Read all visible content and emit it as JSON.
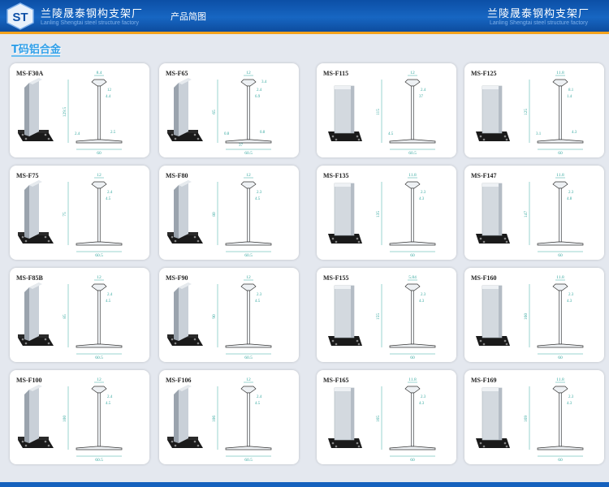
{
  "header": {
    "company_name": "兰陵晟泰钢构支架厂",
    "company_name_en": "Lanling Shengtai steel structure factory",
    "page_label": "产品简图",
    "company_name_right": "兰陵晟泰钢构支架厂",
    "company_name_right_en": "Lanling Shengtai steel structure factory",
    "logo_text": "ST"
  },
  "section": {
    "title": "T码铝合金"
  },
  "colors": {
    "header_blue": "#1766c2",
    "accent_orange": "#f4a21c",
    "dimension_teal": "#36a8a0",
    "title_blue": "#2e9ee8"
  },
  "cards": [
    {
      "id": "F30A",
      "label": "MS-F30A",
      "dims": [
        "8.4",
        "12",
        "4.4",
        "2.4",
        "129.5",
        "60",
        "2.5"
      ]
    },
    {
      "id": "F65",
      "label": "MS-F65",
      "dims": [
        "12",
        "2.4",
        "6.9",
        "65",
        "0.8",
        "0.8",
        "37",
        "3.4",
        "38",
        "60.5",
        "4.8"
      ]
    },
    {
      "id": "F115",
      "label": "MS-F115",
      "dims": [
        "12",
        "2.4",
        "115",
        "37",
        "60.5",
        "4.5"
      ]
    },
    {
      "id": "F125",
      "label": "MS-F125",
      "dims": [
        "11.8",
        "8.1",
        "1.4",
        "3.1",
        "125",
        "60",
        "4.3"
      ]
    },
    {
      "id": "F75",
      "label": "MS-F75",
      "dims": [
        "12",
        "2.4",
        "75",
        "4.5",
        "60.5"
      ]
    },
    {
      "id": "F80",
      "label": "MS-F80",
      "dims": [
        "12",
        "2.3",
        "80",
        "4.5",
        "60.5"
      ]
    },
    {
      "id": "F135",
      "label": "MS-F135",
      "dims": [
        "11.8",
        "2.3",
        "135",
        "4.3",
        "60"
      ]
    },
    {
      "id": "F147",
      "label": "MS-F147",
      "dims": [
        "11.8",
        "2.3",
        "147",
        "4.8",
        "60"
      ]
    },
    {
      "id": "F85B",
      "label": "MS-F85B",
      "dims": [
        "12",
        "2.4",
        "85",
        "4.5",
        "60.5"
      ]
    },
    {
      "id": "F90",
      "label": "MS-F90",
      "dims": [
        "12",
        "2.3",
        "90",
        "4.5",
        "60.5"
      ]
    },
    {
      "id": "F155",
      "label": "MS-F155",
      "dims": [
        "5.84",
        "2.3",
        "155",
        "4.3",
        "60"
      ]
    },
    {
      "id": "F160",
      "label": "MS-F160",
      "dims": [
        "11.8",
        "2.3",
        "160",
        "4.3",
        "60"
      ]
    },
    {
      "id": "F100",
      "label": "MS-F100",
      "dims": [
        "12",
        "2.4",
        "100",
        "4.5",
        "60.5"
      ]
    },
    {
      "id": "F106",
      "label": "MS-F106",
      "dims": [
        "12",
        "2.4",
        "106",
        "4.5",
        "60.5"
      ]
    },
    {
      "id": "F165",
      "label": "MS-F165",
      "dims": [
        "11.8",
        "2.3",
        "165",
        "4.3",
        "60"
      ]
    },
    {
      "id": "F169",
      "label": "MS-F169",
      "dims": [
        "11.8",
        "2.3",
        "169",
        "4.3",
        "60"
      ]
    }
  ]
}
